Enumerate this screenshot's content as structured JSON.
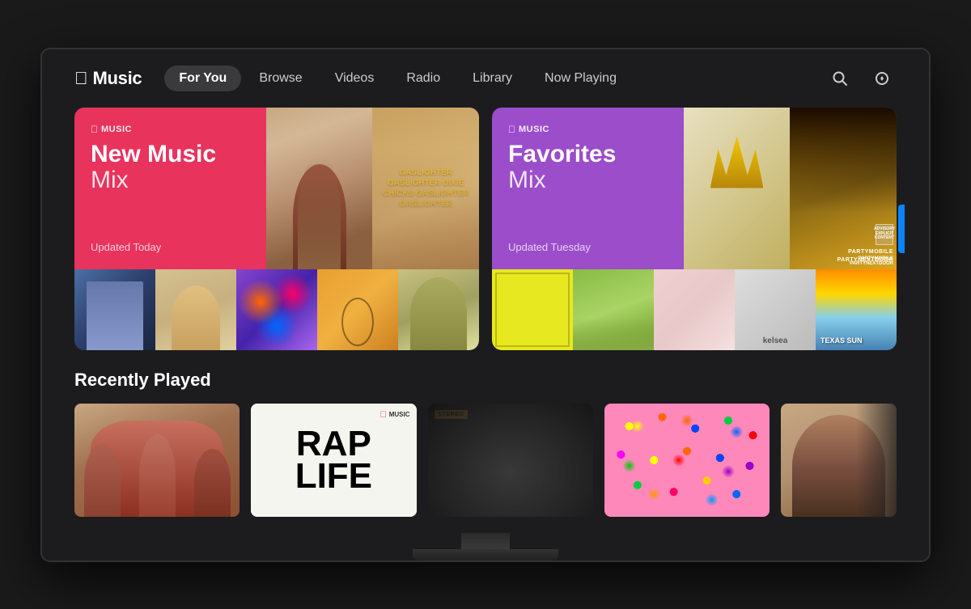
{
  "app": {
    "name": "Music",
    "logo_symbol": ""
  },
  "nav": {
    "items": [
      {
        "label": "For You",
        "active": true
      },
      {
        "label": "Browse",
        "active": false
      },
      {
        "label": "Videos",
        "active": false
      },
      {
        "label": "Radio",
        "active": false
      },
      {
        "label": "Library",
        "active": false
      },
      {
        "label": "Now Playing",
        "active": false
      }
    ],
    "search_icon": "🔍",
    "settings_icon": "⚙"
  },
  "featured": {
    "left_card": {
      "badge": "MUSIC",
      "title": "New Music",
      "subtitle": "Mix",
      "updated": "Updated Today"
    },
    "right_card": {
      "badge": "MUSIC",
      "title": "Favorites",
      "subtitle": "Mix",
      "updated": "Updated Tuesday"
    }
  },
  "album_arts": {
    "gaslighter": "GASLIGHTER\nGASLIGHTER\nDIXIE CHICKS\nGASLIGHTER\nGASLIGHTER",
    "partymobile": "PARTYMOBILE\nPARTYNEXTDOOR",
    "texas_sun": "TEXAS SUN",
    "kelsea": "kelsea",
    "rap_life": "RAP\nLIFE"
  },
  "recently_played": {
    "section_title": "Recently Played",
    "items": [
      {
        "id": "1",
        "type": "band-photo"
      },
      {
        "id": "2",
        "type": "rap-life"
      },
      {
        "id": "3",
        "type": "stereo-dark"
      },
      {
        "id": "4",
        "type": "flowers"
      },
      {
        "id": "5",
        "type": "portrait"
      }
    ]
  },
  "colors": {
    "new_music_mix": "#e8335d",
    "favorites_mix": "#9b4dca",
    "active_tab_bg": "#3a3a3c",
    "background": "#1c1c1e",
    "accent_blue": "#0a84ff"
  }
}
